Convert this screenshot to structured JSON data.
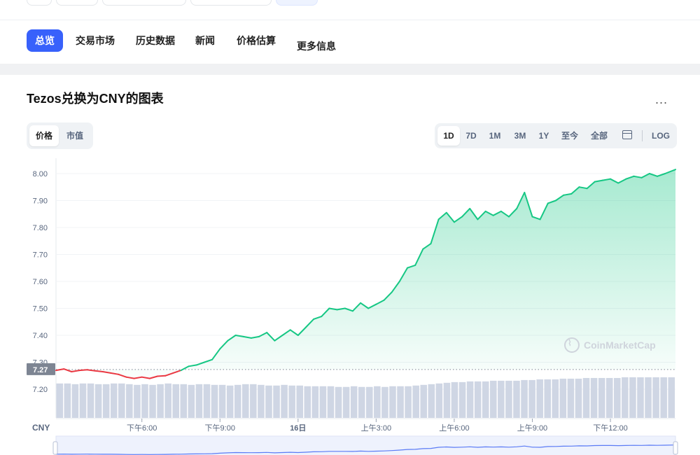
{
  "tabs": [
    {
      "label": "总览",
      "active": true
    },
    {
      "label": "交易市场"
    },
    {
      "label": "历史数据"
    },
    {
      "label": "新闻"
    },
    {
      "label": "价格估算"
    },
    {
      "label": "更多信息"
    }
  ],
  "card": {
    "title": "Tezos兑换为CNY的图表",
    "more": "..."
  },
  "toggle": [
    "价格",
    "市值"
  ],
  "ranges": [
    "1D",
    "7D",
    "1M",
    "3M",
    "1Y",
    "至今",
    "全部",
    "LOG"
  ],
  "watermark": "CoinMarketCap",
  "colors": {
    "accent": "#3861fb",
    "up": "#16c784",
    "down": "#ea3943",
    "volume": "#cfd6e4"
  },
  "chart_data": {
    "type": "line",
    "currency_label": "CNY",
    "current_price_label": "7.27",
    "y_ticks": [
      "8.00",
      "7.90",
      "7.80",
      "7.70",
      "7.60",
      "7.50",
      "7.40",
      "7.30",
      "7.20"
    ],
    "ylim": [
      7.2,
      8.0
    ],
    "x_ticks": [
      "下午6:00",
      "下午9:00",
      "16日",
      "上午3:00",
      "上午6:00",
      "上午9:00",
      "下午12:00"
    ],
    "x_tick_hours": [
      3,
      6,
      9,
      12,
      15,
      18,
      21
    ],
    "x_range_hours": [
      -0.3,
      23.5
    ],
    "reference_price": 7.273,
    "series": [
      {
        "x": [
          -0.3,
          0.0,
          0.3,
          0.6,
          0.9,
          1.2,
          1.5,
          1.8,
          2.1,
          2.4,
          2.7,
          3.0,
          3.3,
          3.6,
          3.9,
          4.2,
          4.5,
          4.8,
          5.1,
          5.4,
          5.7,
          6.0,
          6.3,
          6.6,
          6.9,
          7.2,
          7.5,
          7.8,
          8.1,
          8.4,
          8.7,
          9.0,
          9.3,
          9.6,
          9.9,
          10.2,
          10.5,
          10.8,
          11.1,
          11.4,
          11.7,
          12.0,
          12.3,
          12.6,
          12.9,
          13.2,
          13.5,
          13.8,
          14.1,
          14.4,
          14.7,
          15.0,
          15.3,
          15.6,
          15.9,
          16.2,
          16.5,
          16.8,
          17.1,
          17.4,
          17.7,
          18.0,
          18.3,
          18.6,
          18.9,
          19.2,
          19.5,
          19.8,
          20.1,
          20.4,
          20.7,
          21.0,
          21.3,
          21.6,
          21.9,
          22.2,
          22.5,
          22.8,
          23.1,
          23.5
        ],
        "y": [
          7.27,
          7.275,
          7.265,
          7.27,
          7.272,
          7.268,
          7.265,
          7.26,
          7.255,
          7.245,
          7.24,
          7.245,
          7.24,
          7.248,
          7.25,
          7.26,
          7.27,
          7.285,
          7.29,
          7.3,
          7.31,
          7.35,
          7.38,
          7.4,
          7.395,
          7.39,
          7.395,
          7.41,
          7.38,
          7.4,
          7.42,
          7.4,
          7.43,
          7.46,
          7.47,
          7.5,
          7.495,
          7.5,
          7.49,
          7.52,
          7.5,
          7.515,
          7.53,
          7.56,
          7.6,
          7.65,
          7.66,
          7.72,
          7.74,
          7.83,
          7.855,
          7.82,
          7.84,
          7.87,
          7.83,
          7.86,
          7.845,
          7.86,
          7.84,
          7.87,
          7.93,
          7.84,
          7.83,
          7.89,
          7.9,
          7.92,
          7.925,
          7.95,
          7.945,
          7.97,
          7.975,
          7.98,
          7.965,
          7.98,
          7.99,
          7.985,
          8.0,
          7.99,
          8.0,
          8.015
        ]
      }
    ],
    "volume": [
      0.5,
      0.5,
      0.49,
      0.5,
      0.5,
      0.49,
      0.49,
      0.5,
      0.5,
      0.49,
      0.48,
      0.49,
      0.48,
      0.49,
      0.5,
      0.49,
      0.49,
      0.48,
      0.49,
      0.49,
      0.48,
      0.48,
      0.47,
      0.48,
      0.49,
      0.49,
      0.48,
      0.47,
      0.47,
      0.48,
      0.47,
      0.47,
      0.46,
      0.46,
      0.46,
      0.46,
      0.45,
      0.45,
      0.46,
      0.45,
      0.45,
      0.46,
      0.45,
      0.46,
      0.46,
      0.46,
      0.47,
      0.48,
      0.49,
      0.5,
      0.51,
      0.52,
      0.52,
      0.53,
      0.53,
      0.53,
      0.54,
      0.54,
      0.54,
      0.54,
      0.55,
      0.55,
      0.56,
      0.56,
      0.56,
      0.57,
      0.57,
      0.57,
      0.58,
      0.58,
      0.58,
      0.58,
      0.58,
      0.59,
      0.59,
      0.59,
      0.59,
      0.59,
      0.59,
      0.59
    ]
  }
}
